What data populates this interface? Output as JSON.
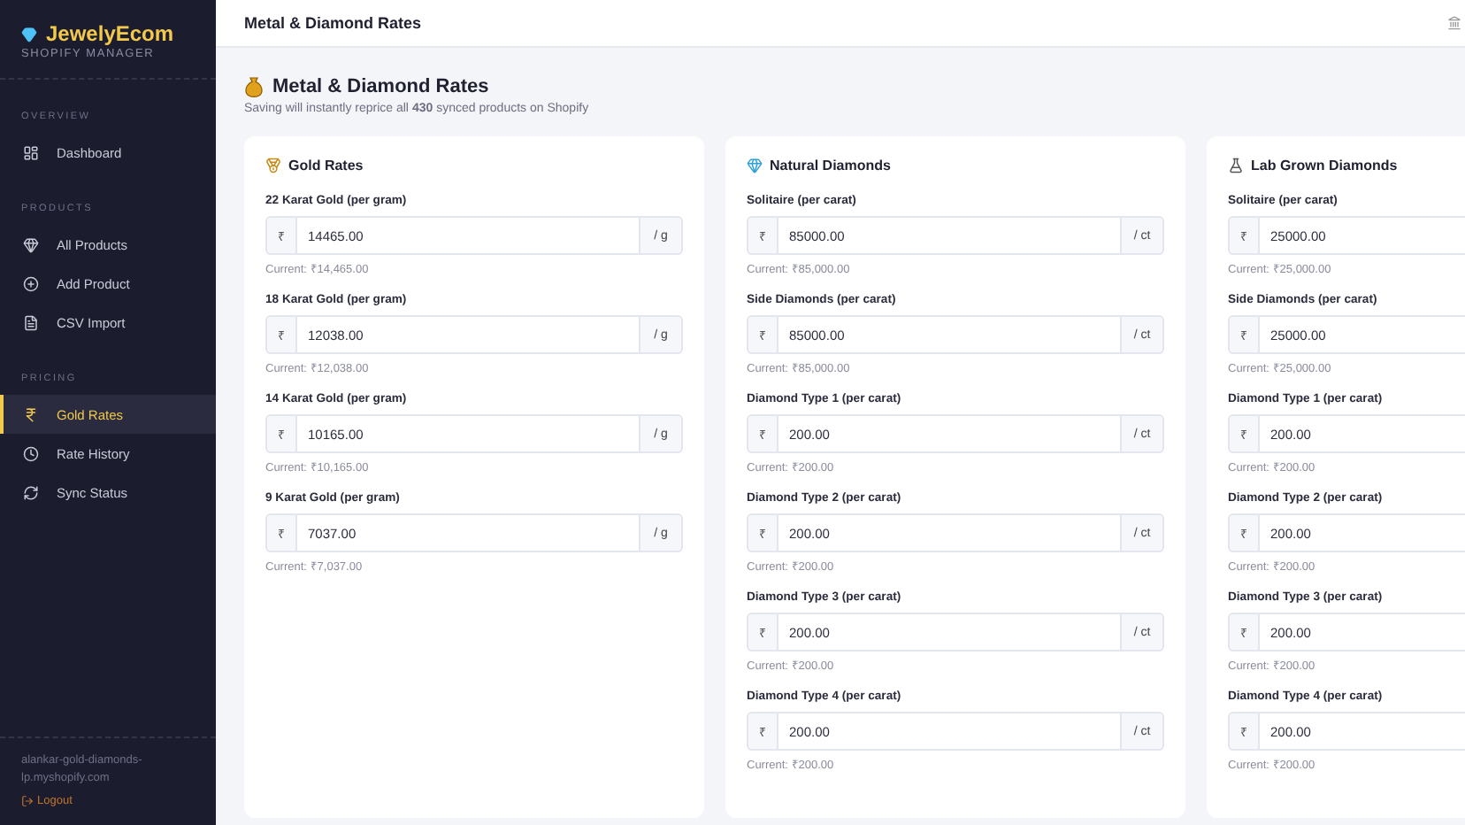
{
  "sidebar": {
    "brand": "JewelyEcom",
    "subtitle": "SHOPIFY MANAGER",
    "sections": [
      {
        "label": "OVERVIEW",
        "items": [
          {
            "label": "Dashboard",
            "selected": false
          }
        ]
      },
      {
        "label": "PRODUCTS",
        "items": [
          {
            "label": "All Products",
            "selected": false
          },
          {
            "label": "Add Product",
            "selected": false
          },
          {
            "label": "CSV Import",
            "selected": false
          }
        ]
      },
      {
        "label": "PRICING",
        "items": [
          {
            "label": "Gold Rates",
            "selected": true
          },
          {
            "label": "Rate History",
            "selected": false
          },
          {
            "label": "Sync Status",
            "selected": false
          }
        ]
      }
    ],
    "store": "alankar-gold-diamonds-lp.myshopify.com",
    "logout": "Logout"
  },
  "header": {
    "title": "Metal & Diamond Rates"
  },
  "page": {
    "title": "Metal & Diamond Rates",
    "subtitle": "Saving will instantly reprice all **430** synced products on Shopify"
  },
  "cards": [
    {
      "title": "Gold Rates",
      "fields": [
        {
          "label": "22 Karat Gold (per gram)",
          "currency": "₹",
          "value": "14465.00",
          "unit": "/ g",
          "current": "Current: ₹14,465.00"
        },
        {
          "label": "18 Karat Gold (per gram)",
          "currency": "₹",
          "value": "12038.00",
          "unit": "/ g",
          "current": "Current: ₹12,038.00"
        },
        {
          "label": "14 Karat Gold (per gram)",
          "currency": "₹",
          "value": "10165.00",
          "unit": "/ g",
          "current": "Current: ₹10,165.00"
        },
        {
          "label": "9 Karat Gold (per gram)",
          "currency": "₹",
          "value": "7037.00",
          "unit": "/ g",
          "current": "Current: ₹7,037.00"
        }
      ]
    },
    {
      "title": "Natural Diamonds",
      "fields": [
        {
          "label": "Solitaire (per carat)",
          "currency": "₹",
          "value": "85000.00",
          "unit": "/ ct",
          "current": "Current: ₹85,000.00"
        },
        {
          "label": "Side Diamonds (per carat)",
          "currency": "₹",
          "value": "85000.00",
          "unit": "/ ct",
          "current": "Current: ₹85,000.00"
        },
        {
          "label": "Diamond Type 1 (per carat)",
          "currency": "₹",
          "value": "200.00",
          "unit": "/ ct",
          "current": "Current: ₹200.00"
        },
        {
          "label": "Diamond Type 2 (per carat)",
          "currency": "₹",
          "value": "200.00",
          "unit": "/ ct",
          "current": "Current: ₹200.00"
        },
        {
          "label": "Diamond Type 3 (per carat)",
          "currency": "₹",
          "value": "200.00",
          "unit": "/ ct",
          "current": "Current: ₹200.00"
        },
        {
          "label": "Diamond Type 4 (per carat)",
          "currency": "₹",
          "value": "200.00",
          "unit": "/ ct",
          "current": "Current: ₹200.00"
        }
      ]
    },
    {
      "title": "Lab Grown Diamonds",
      "fields": [
        {
          "label": "Solitaire (per carat)",
          "currency": "₹",
          "value": "25000.00",
          "current": "Current: ₹25,000.00"
        },
        {
          "label": "Side Diamonds (per carat)",
          "currency": "₹",
          "value": "25000.00",
          "current": "Current: ₹25,000.00"
        },
        {
          "label": "Diamond Type 1 (per carat)",
          "currency": "₹",
          "value": "200.00",
          "current": "Current: ₹200.00"
        },
        {
          "label": "Diamond Type 2 (per carat)",
          "currency": "₹",
          "value": "200.00",
          "current": "Current: ₹200.00"
        },
        {
          "label": "Diamond Type 3 (per carat)",
          "currency": "₹",
          "value": "200.00",
          "current": "Current: ₹200.00"
        },
        {
          "label": "Diamond Type 4 (per carat)",
          "currency": "₹",
          "value": "200.00",
          "current": "Current: ₹200.00"
        }
      ]
    }
  ]
}
